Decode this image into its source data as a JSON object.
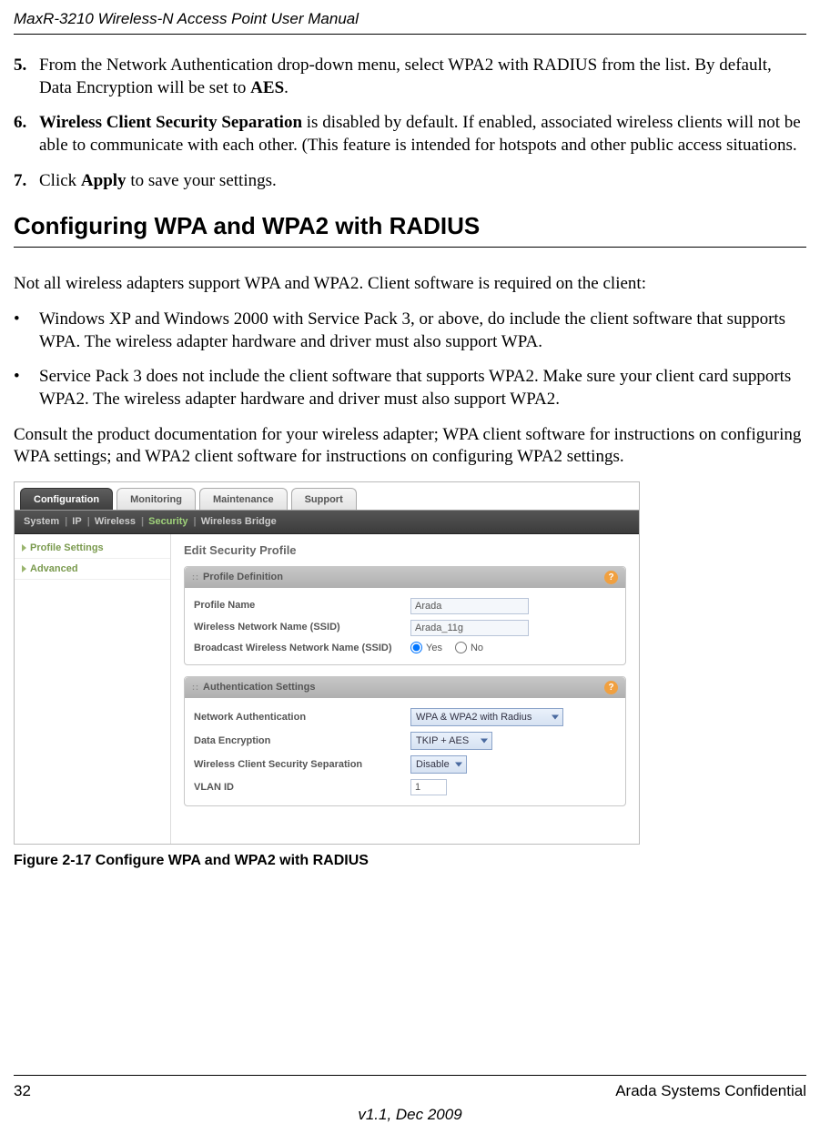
{
  "header": "MaxR-3210 Wireless-N Access Point User Manual",
  "steps": {
    "s5_num": "5.",
    "s5_a": "From the Network Authentication drop-down menu, select WPA2 with RADIUS from the list. By default, Data Encryption will be set to ",
    "s5_b": "AES",
    "s5_c": ".",
    "s6_num": "6.",
    "s6_a": "Wireless Client Security Separation",
    "s6_b": " is disabled by default. If enabled, associated wireless clients will not be able to communicate with each other. (This feature is intended for hotspots and other public access situations.",
    "s7_num": "7.",
    "s7_a": "Click ",
    "s7_b": "Apply",
    "s7_c": " to save your settings."
  },
  "h2": "Configuring WPA and WPA2 with RADIUS",
  "paras": {
    "p1": "Not all wireless adapters support WPA and WPA2. Client software is required on the client:",
    "b1": "Windows XP and Windows 2000 with Service Pack 3, or above, do include the client software that supports WPA. The wireless adapter hardware and driver must also support WPA.",
    "b2": "Service Pack 3 does not include the client software that supports WPA2. Make sure your client card supports WPA2. The wireless adapter hardware and driver must also support WPA2.",
    "p2": "Consult the product documentation for your wireless adapter; WPA client software for instructions on configuring WPA settings; and WPA2 client software for instructions on configuring WPA2 settings."
  },
  "shot": {
    "tabs": [
      "Configuration",
      "Monitoring",
      "Maintenance",
      "Support"
    ],
    "subtabs": {
      "items": [
        "System",
        "IP",
        "Wireless",
        "Security",
        "Wireless Bridge"
      ],
      "active": "Security"
    },
    "sidebar": [
      "Profile Settings",
      "Advanced"
    ],
    "title": "Edit Security Profile",
    "panel1": {
      "title": "Profile Definition",
      "rows": {
        "name_label": "Profile Name",
        "name_value": "Arada",
        "ssid_label": "Wireless Network Name (SSID)",
        "ssid_value": "Arada_11g",
        "bcast_label": "Broadcast Wireless Network Name (SSID)",
        "yes": "Yes",
        "no": "No"
      }
    },
    "panel2": {
      "title": "Authentication Settings",
      "rows": {
        "auth_label": "Network Authentication",
        "auth_value": "WPA & WPA2 with Radius",
        "enc_label": "Data Encryption",
        "enc_value": "TKIP + AES",
        "sep_label": "Wireless Client Security Separation",
        "sep_value": "Disable",
        "vlan_label": "VLAN ID",
        "vlan_value": "1"
      }
    }
  },
  "figcap": "Figure 2-17  Configure WPA and WPA2 with RADIUS",
  "footer": {
    "page": "32",
    "conf": "Arada Systems Confidential",
    "ver": "v1.1, Dec 2009"
  }
}
